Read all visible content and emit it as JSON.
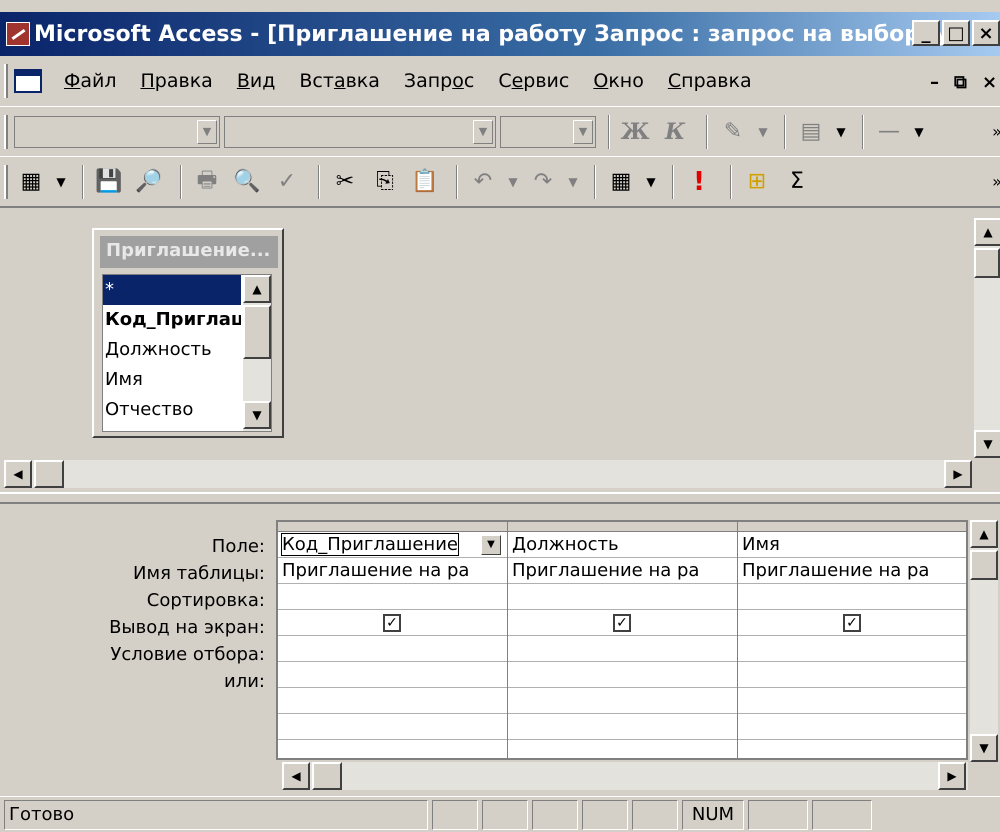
{
  "window": {
    "title": "Microsoft Access - [Приглашение на работу Запрос : запрос на выборку]"
  },
  "menu": {
    "items": [
      {
        "pre": "",
        "u": "Ф",
        "post": "айл"
      },
      {
        "pre": "",
        "u": "П",
        "post": "равка"
      },
      {
        "pre": "",
        "u": "В",
        "post": "ид"
      },
      {
        "pre": "Вст",
        "u": "а",
        "post": "вка"
      },
      {
        "pre": "Запр",
        "u": "о",
        "post": "с"
      },
      {
        "pre": "С",
        "u": "е",
        "post": "рвис"
      },
      {
        "pre": "",
        "u": "О",
        "post": "кно"
      },
      {
        "pre": "",
        "u": "С",
        "post": "правка"
      }
    ]
  },
  "formatting_toolbar": {
    "bold_label": "Ж",
    "italic_label": "К"
  },
  "fieldlist": {
    "title": "Приглашение...",
    "items": [
      "*",
      "Код_Приглаш",
      "Должность",
      "Имя",
      "Отчество"
    ]
  },
  "grid": {
    "row_labels": [
      "Поле:",
      "Имя таблицы:",
      "Сортировка:",
      "Вывод на экран:",
      "Условие отбора:",
      "или:"
    ],
    "columns": [
      {
        "field": "Код_Приглашение",
        "table": "Приглашение на ра",
        "show": true
      },
      {
        "field": "Должность",
        "table": "Приглашение на ра",
        "show": true
      },
      {
        "field": "Имя",
        "table": "Приглашение на ра",
        "show": true
      }
    ]
  },
  "status": {
    "text": "Готово",
    "num": "NUM"
  }
}
